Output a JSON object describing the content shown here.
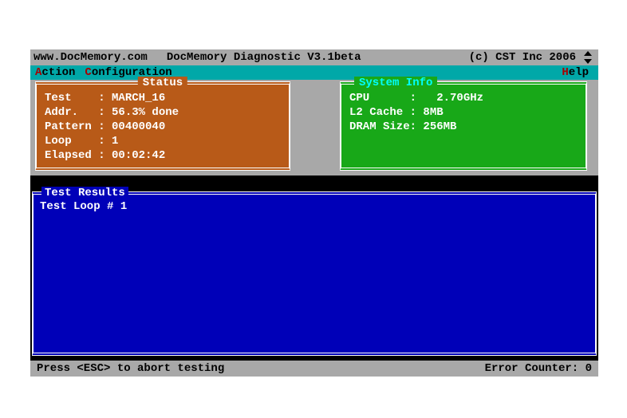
{
  "titlebar": {
    "url": "www.DocMemory.com",
    "app": "DocMemory Diagnostic V3.1beta",
    "copyright": "(c) CST Inc 2006"
  },
  "menu": {
    "action": {
      "hot": "A",
      "rest": "ction"
    },
    "config": {
      "hot": "C",
      "rest": "onfiguration"
    },
    "help": {
      "hot": "H",
      "rest": "elp"
    }
  },
  "status": {
    "legend": "Status",
    "test": {
      "label": "Test    : ",
      "value": "MARCH_16"
    },
    "addr": {
      "label": "Addr.   : ",
      "value": "56.3% done"
    },
    "pattern": {
      "label": "Pattern : ",
      "value": "00400040"
    },
    "loop": {
      "label": "Loop    : ",
      "value": "1"
    },
    "elapsed": {
      "label": "Elapsed : ",
      "value": "00:02:42"
    }
  },
  "sysinfo": {
    "legend": "System Info",
    "cpu": {
      "label": "CPU      :   ",
      "value": "2.70GHz"
    },
    "l2": {
      "label": "L2 Cache : ",
      "value": "8MB"
    },
    "dram": {
      "label": "DRAM Size: ",
      "value": "256MB"
    }
  },
  "results": {
    "legend": "Test Results",
    "line1": "Test Loop # 1"
  },
  "footer": {
    "hint": "Press <ESC> to abort testing",
    "errlabel": "Error Counter: ",
    "errvalue": "0"
  }
}
